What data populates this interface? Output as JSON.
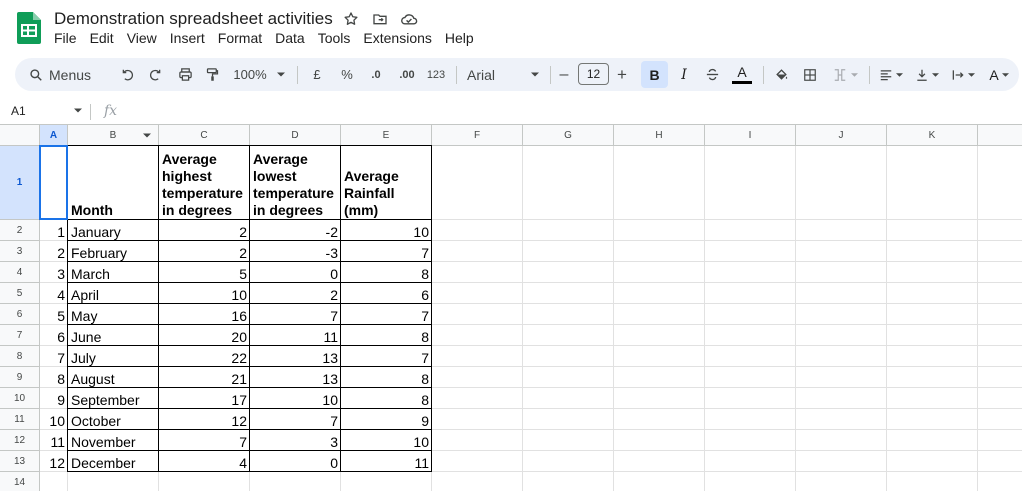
{
  "app": {
    "doc_title": "Demonstration spreadsheet activities",
    "icons": [
      "star-icon",
      "move-to-folder-icon",
      "cloud-saved-icon"
    ],
    "brand_color": "#0f9d58"
  },
  "menubar": [
    "File",
    "Edit",
    "View",
    "Insert",
    "Format",
    "Data",
    "Tools",
    "Extensions",
    "Help"
  ],
  "toolbar": {
    "menus_label": "Menus",
    "zoom": "100%",
    "currency": "£",
    "percent": "%",
    "decrease_decimal": ".0",
    "increase_decimal": ".00",
    "number_format": "123",
    "font": "Arial",
    "font_size": "12",
    "minus": "–",
    "plus": "+",
    "bold": "B",
    "italic": "I",
    "text_color": "A",
    "active_color": "#d3e3fd"
  },
  "formula_bar": {
    "cell_ref": "A1",
    "fx": "fx",
    "value": ""
  },
  "columns": [
    "A",
    "B",
    "C",
    "D",
    "E",
    "F",
    "G",
    "H",
    "I",
    "J",
    "K"
  ],
  "rows": [
    "1",
    "2",
    "3",
    "4",
    "5",
    "6",
    "7",
    "8",
    "9",
    "10",
    "11",
    "12",
    "13",
    "14"
  ],
  "sheet": {
    "headers": {
      "month": "Month",
      "high": [
        "Average",
        "highest",
        "temperature",
        "in degrees"
      ],
      "low": [
        "Average",
        "lowest",
        "temperature",
        "in degrees"
      ],
      "rain": [
        "Average",
        "Rainfall",
        "(mm)"
      ]
    },
    "data": [
      {
        "n": "1",
        "month": "January",
        "high": "2",
        "low": "-2",
        "rain": "10"
      },
      {
        "n": "2",
        "month": "February",
        "high": "2",
        "low": "-3",
        "rain": "7"
      },
      {
        "n": "3",
        "month": "March",
        "high": "5",
        "low": "0",
        "rain": "8"
      },
      {
        "n": "4",
        "month": "April",
        "high": "10",
        "low": "2",
        "rain": "6"
      },
      {
        "n": "5",
        "month": "May",
        "high": "16",
        "low": "7",
        "rain": "7"
      },
      {
        "n": "6",
        "month": "June",
        "high": "20",
        "low": "11",
        "rain": "8"
      },
      {
        "n": "7",
        "month": "July",
        "high": "22",
        "low": "13",
        "rain": "7"
      },
      {
        "n": "8",
        "month": "August",
        "high": "21",
        "low": "13",
        "rain": "8"
      },
      {
        "n": "9",
        "month": "September",
        "high": "17",
        "low": "10",
        "rain": "8"
      },
      {
        "n": "10",
        "month": "October",
        "high": "12",
        "low": "7",
        "rain": "9"
      },
      {
        "n": "11",
        "month": "November",
        "high": "7",
        "low": "3",
        "rain": "10"
      },
      {
        "n": "12",
        "month": "December",
        "high": "4",
        "low": "0",
        "rain": "11"
      }
    ]
  }
}
